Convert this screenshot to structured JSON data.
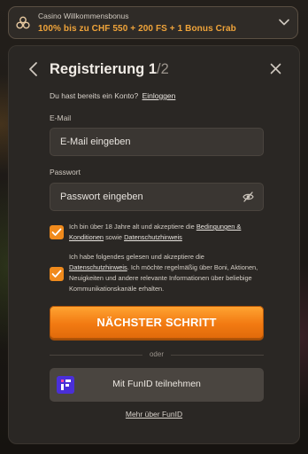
{
  "bonus": {
    "title": "Casino Willkommensbonus",
    "text": "100% bis zu CHF 550 + 200 FS + 1 Bonus Crab"
  },
  "modal": {
    "title_main": "Registrierung 1",
    "title_step": "/2",
    "account_prompt": "Du hast bereits ein Konto?",
    "login_link": "Einloggen",
    "email_label": "E-Mail",
    "email_placeholder": "E-Mail eingeben",
    "password_label": "Passwort",
    "password_placeholder": "Passwort eingeben",
    "consent1": {
      "text_a": "Ich bin über 18 Jahre alt und akzeptiere die",
      "link_terms": "Bedingungen & Konditionen",
      "text_b": "sowie",
      "link_privacy": "Datenschutzhinweis"
    },
    "consent2": {
      "text_a": "Ich habe folgendes gelesen und akzeptiere die",
      "link_privacy": "Datenschutzhinweis",
      "text_b": ". Ich möchte regelmäßig über Boni, Aktionen, Neuigkeiten und andere relevante Informationen über beliebige Kommunikationskanäle erhalten."
    },
    "next_button": "NÄCHSTER SCHRITT",
    "or": "oder",
    "funid_button": "Mit FunID teilnehmen",
    "more_link": "Mehr über FunID"
  },
  "colors": {
    "accent": "#f08a1c",
    "bonus_text": "#f0a43a",
    "modal_bg": "#2a2724",
    "input_bg": "#3a3632"
  }
}
